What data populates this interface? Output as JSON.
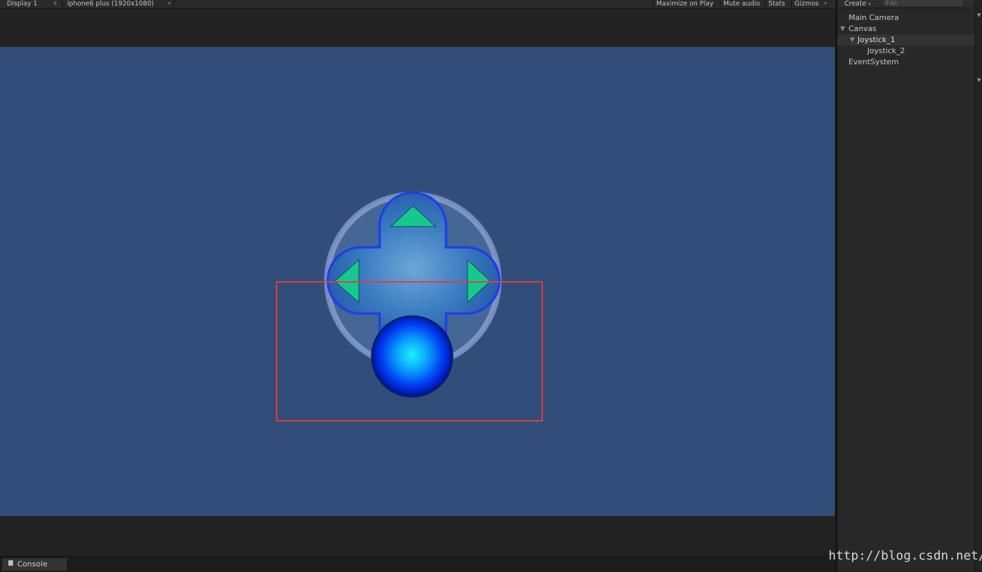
{
  "game_toolbar": {
    "display": "Display 1",
    "resolution": "iphone6 plus (1920x1080)",
    "maximize_on_play": "Maximize on Play",
    "mute_audio": "Mute audio",
    "stats": "Stats",
    "gizmos": "Gizmos"
  },
  "hierarchy": {
    "create": "Create",
    "search_placeholder": "All",
    "items": [
      {
        "label": "Main Camera"
      },
      {
        "label": "Canvas"
      },
      {
        "label": "Joystick_1"
      },
      {
        "label": "Joystick_2"
      },
      {
        "label": "EventSystem"
      }
    ]
  },
  "console": {
    "tab_label": "Console"
  },
  "watermark": "http://blog.csdn.net/",
  "colors": {
    "viewport_bg": "#314e7a",
    "selection_border": "#e63a3a",
    "arrow_fill": "#17c88e",
    "knob_center": "#19e6ff",
    "knob_edge": "#0010c8"
  },
  "icons": {
    "dropdown": "triangle-down",
    "fold_open": "triangle-down",
    "search": "magnifier"
  }
}
